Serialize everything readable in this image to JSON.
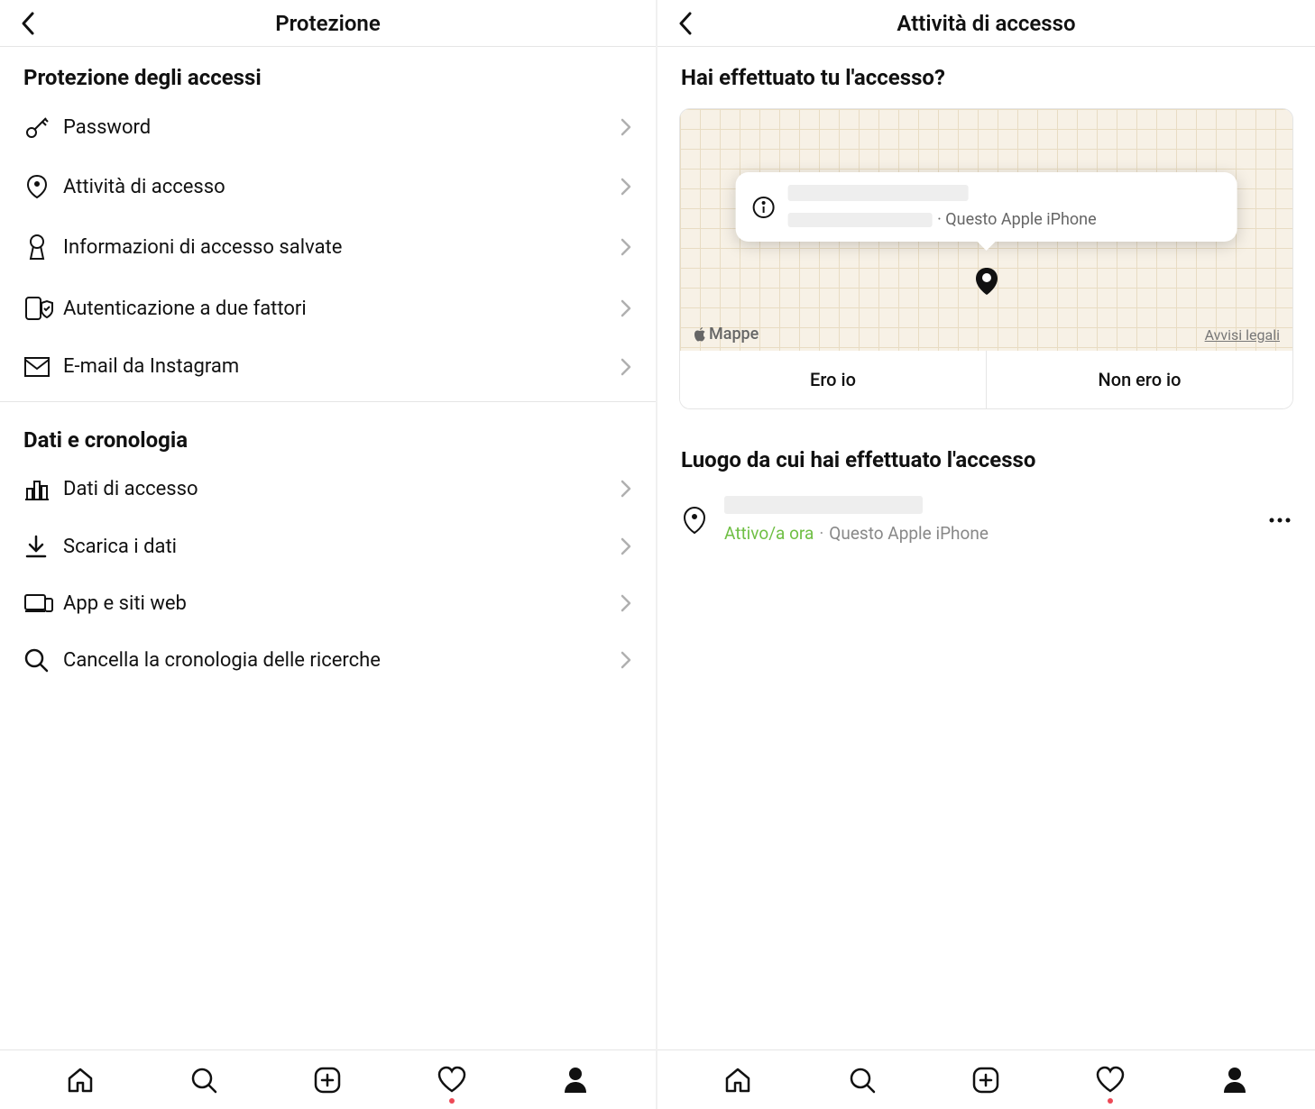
{
  "left": {
    "title": "Protezione",
    "section1": {
      "title": "Protezione degli accessi",
      "items": [
        {
          "label": "Password",
          "icon": "key-icon"
        },
        {
          "label": "Attività di accesso",
          "icon": "map-pin-icon"
        },
        {
          "label": "Informazioni di accesso salvate",
          "icon": "keyhole-icon"
        },
        {
          "label": "Autenticazione a due fattori",
          "icon": "shield-phone-icon"
        },
        {
          "label": "E-mail da Instagram",
          "icon": "mail-icon"
        }
      ]
    },
    "section2": {
      "title": "Dati e cronologia",
      "items": [
        {
          "label": "Dati di accesso",
          "icon": "chart-icon"
        },
        {
          "label": "Scarica i dati",
          "icon": "download-icon"
        },
        {
          "label": "App e siti web",
          "icon": "devices-icon"
        },
        {
          "label": "Cancella la cronologia delle ricerche",
          "icon": "search-icon"
        }
      ]
    }
  },
  "right": {
    "title": "Attività di accesso",
    "question": "Hai effettuato tu l'accesso?",
    "popup_device": "· Questo Apple iPhone",
    "map_brand": "Mappe",
    "map_legal": "Avvisi legali",
    "btn_yes": "Ero io",
    "btn_no": "Non ero io",
    "locations_title": "Luogo da cui hai effettuato l'accesso",
    "entry": {
      "status": "Attivo/a ora",
      "separator": "·",
      "device": "Questo Apple iPhone"
    }
  }
}
